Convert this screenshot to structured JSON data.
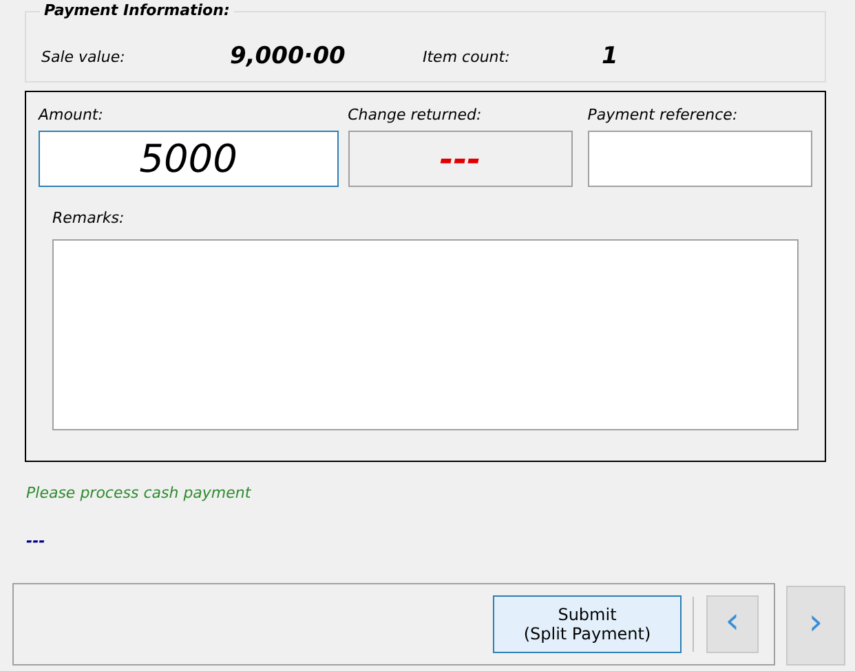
{
  "payment_information": {
    "title": "Payment Information:",
    "sale_value_label": "Sale value:",
    "sale_value": "9,000·00",
    "item_count_label": "Item count:",
    "item_count": "1"
  },
  "amount": {
    "label": "Amount:",
    "value": "5000"
  },
  "change_returned": {
    "label": "Change returned:",
    "value": "---"
  },
  "payment_reference": {
    "label": "Payment reference:"
  },
  "remarks": {
    "label": "Remarks:"
  },
  "message": "Please process cash payment",
  "status": "---",
  "buttons": {
    "submit": "Submit\n(Split Payment)",
    "previous": "‹",
    "next": "›"
  }
}
